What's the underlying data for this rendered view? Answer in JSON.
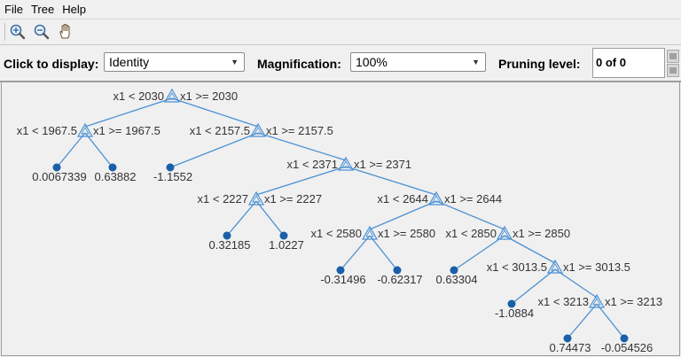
{
  "menu": {
    "items": [
      {
        "label": "File"
      },
      {
        "label": "Tree"
      },
      {
        "label": "Help"
      }
    ]
  },
  "toolbar": {
    "icons": [
      "zoom-in-icon",
      "zoom-out-icon",
      "pan-hand-icon"
    ]
  },
  "controls": {
    "display_label": "Click to display:",
    "display_value": "Identity",
    "magnification_label": "Magnification:",
    "magnification_value": "100%",
    "pruning_label": "Pruning level:",
    "pruning_value": "0 of 0"
  },
  "colors": {
    "edge": "#4a90d2",
    "leaf": "#1a5fa8",
    "node_stroke": "#4a90d2"
  },
  "tree": {
    "branches": [
      {
        "left": "x1 < 2030",
        "right": "x1 >= 2030"
      },
      {
        "left": "x1 < 1967.5",
        "right": "x1 >= 1967.5"
      },
      {
        "left": "x1 < 2157.5",
        "right": "x1 >= 2157.5"
      },
      {
        "left": "x1 < 2371",
        "right": "x1 >= 2371"
      },
      {
        "left": "x1 < 2227",
        "right": "x1 >= 2227"
      },
      {
        "left": "x1 < 2644",
        "right": "x1 >= 2644"
      },
      {
        "left": "x1 < 2580",
        "right": "x1 >= 2580"
      },
      {
        "left": "x1 < 2850",
        "right": "x1 >= 2850"
      },
      {
        "left": "x1 < 3013.5",
        "right": "x1 >= 3013.5"
      },
      {
        "left": "x1 < 3213",
        "right": "x1 >= 3213"
      }
    ],
    "leaves": [
      "0.0067339",
      "0.63882",
      "-1.1552",
      "0.32185",
      "1.0227",
      "-0.31496",
      "-0.62317",
      "0.63304",
      "-1.0884",
      "0.74473",
      "-0.054526"
    ]
  }
}
